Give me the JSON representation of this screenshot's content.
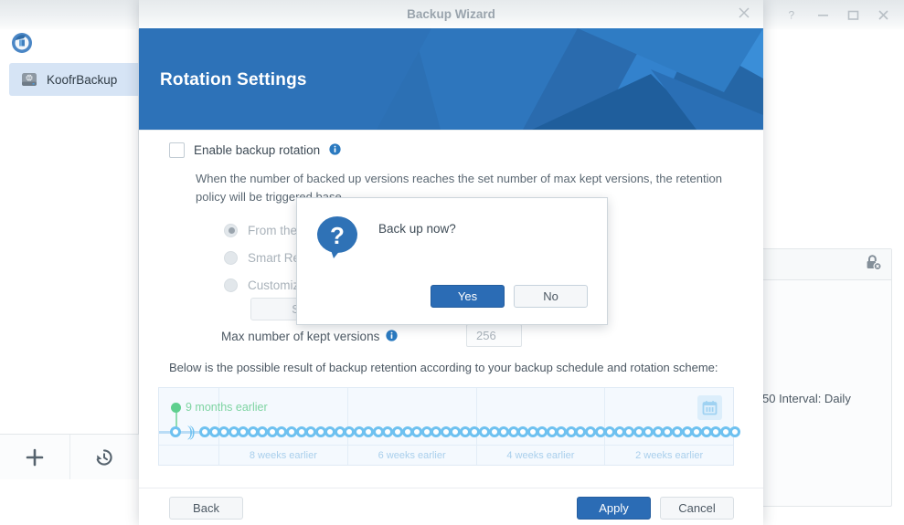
{
  "window": {
    "controls": [
      {
        "name": "help-button",
        "glyph": "?"
      },
      {
        "name": "minimize-button",
        "glyph": "—"
      },
      {
        "name": "maximize-button",
        "glyph": "□"
      },
      {
        "name": "close-button",
        "glyph": "✕"
      }
    ]
  },
  "sidebar": {
    "logo_icon": "app-logo-icon",
    "items": [
      {
        "label": "KoofrBackup",
        "icon": "drive-icon",
        "selected": true
      }
    ],
    "bottom_actions": [
      {
        "name": "add-task-button",
        "icon": "plus-icon"
      },
      {
        "name": "restore-history-button",
        "icon": "history-icon"
      }
    ]
  },
  "background_panel": {
    "lock_icon": "lock-disabled-icon",
    "info_line": "50 Interval: Daily"
  },
  "wizard": {
    "title": "Backup Wizard",
    "close_icon": "close-icon",
    "hero_title": "Rotation Settings",
    "enable_rotation": {
      "label": "Enable backup rotation",
      "checked": false,
      "info_icon": "info-icon"
    },
    "description": "When the number of backed up versions reaches the set number of max kept versions, the retention policy will be triggered base",
    "radios": [
      {
        "label": "From the",
        "selected": true
      },
      {
        "label": "Smart Re",
        "selected": false
      },
      {
        "label": "Customize",
        "selected": false
      }
    ],
    "settings_button": "Setting",
    "max_versions": {
      "label": "Max number of kept versions",
      "info_icon": "info-icon",
      "value": "256"
    },
    "below_text": "Below is the possible result of backup retention according to your backup schedule and rotation scheme:",
    "footer_buttons": {
      "back": "Back",
      "apply": "Apply",
      "cancel": "Cancel"
    }
  },
  "timeline": {
    "marker_label": "9 months earlier",
    "marker_color": "#5ecf8e",
    "node_color": "#6ec1f0",
    "calendar_icon": "calendar-icon",
    "break_glyph": "))",
    "axis_labels": [
      "",
      "8 weeks earlier",
      "6 weeks earlier",
      "4 weeks earlier",
      "2 weeks earlier"
    ],
    "node_count": 56
  },
  "modal": {
    "icon": "question-bubble-icon",
    "message": "Back up now?",
    "yes_label": "Yes",
    "no_label": "No"
  }
}
